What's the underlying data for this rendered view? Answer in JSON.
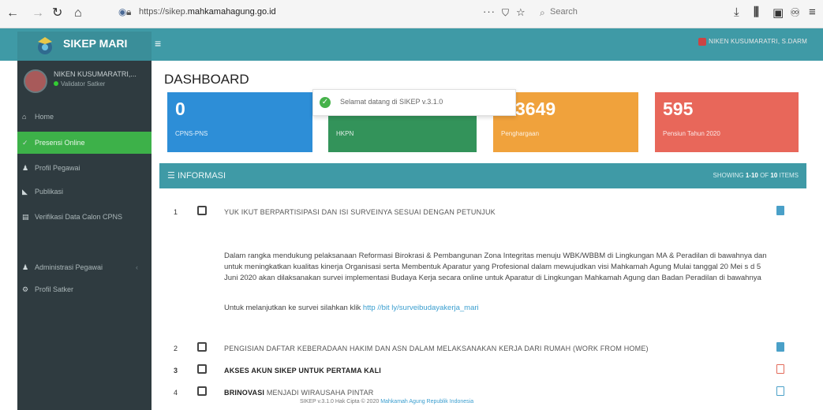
{
  "browser": {
    "url_prefix": "https://sikep.",
    "url_domain": "mahkamahagung.go.id",
    "search_placeholder": "Search"
  },
  "app": {
    "name": "SIKEP MARI",
    "top_user": "NIKEN KUSUMARATRI, S.DARM"
  },
  "sidebar": {
    "user_name": "NIKEN KUSUMARATRI,...",
    "user_status": "Validator Satker",
    "items": [
      {
        "label": "Home",
        "icon": "home-icon"
      },
      {
        "label": "Presensi Online",
        "icon": "check-icon"
      },
      {
        "label": "Profil Pegawai",
        "icon": "user-icon"
      },
      {
        "label": "Publikasi",
        "icon": "megaphone-icon"
      },
      {
        "label": "Verifikasi Data Calon CPNS",
        "icon": "file-icon"
      },
      {
        "label": "Administrasi Pegawai",
        "icon": "user-icon"
      },
      {
        "label": "Profil Satker",
        "icon": "gear-icon"
      }
    ]
  },
  "dashboard": {
    "title": "DASHBOARD",
    "stats": [
      {
        "value": "0",
        "label": "CPNS-PNS",
        "color": "#2d8ed7"
      },
      {
        "value": "",
        "label": "HKPN",
        "color": "#33935a"
      },
      {
        "value": "3649",
        "label": "Penghargaan",
        "color": "#f0a23c"
      },
      {
        "value": "595",
        "label": "Pensiun Tahun 2020",
        "color": "#e8675a"
      }
    ],
    "toast": "Selamat datang di SIKEP v.3.1.0"
  },
  "info": {
    "title": "INFORMASI",
    "showing_prefix": "SHOWING ",
    "showing_range": "1-10",
    "showing_mid": " OF ",
    "showing_total": "10",
    "showing_suffix": " ITEMS",
    "items": [
      {
        "num": "1",
        "title": "YUK IKUT BERPARTISIPASI DAN ISI SURVEINYA SESUAI DENGAN PETUNJUK"
      },
      {
        "num": "2",
        "title": "PENGISIAN DAFTAR KEBERADAAN HAKIM DAN ASN DALAM MELAKSANAKAN KERJA DARI RUMAH (WORK FROM HOME)"
      },
      {
        "num": "3",
        "title": "AKSES AKUN SIKEP UNTUK PERTAMA KALI"
      },
      {
        "num": "4",
        "title_bold": "BRINOVASI",
        "title_rest": " MENJADI WIRAUSAHA PINTAR"
      }
    ],
    "body": "Dalam rangka mendukung pelaksanaan Reformasi Birokrasi & Pembangunan Zona Integritas menuju WBK/WBBM di Lingkungan MA & Peradilan di bawahnya  dan untuk meningkatkan kualitas kinerja Organisasi serta Membentuk Aparatur yang Profesional dalam mewujudkan visi Mahkamah Agung  Mulai tanggal 20 Mei s d 5 Juni 2020 akan dilaksanakan survei implementasi Budaya Kerja secara online untuk Aparatur di Lingkungan Mahkamah Agung dan Badan Peradilan di bawahnya",
    "body2_prefix": "Untuk melanjutkan ke survei  silahkan klik ",
    "body2_link": "http //bit ly/surveibudayakerja_mari"
  },
  "footer": {
    "text": "SIKEP v.3.1.0 Hak Cipta © 2020 ",
    "org": "Mahkamah Agung Republik Indonesia"
  }
}
